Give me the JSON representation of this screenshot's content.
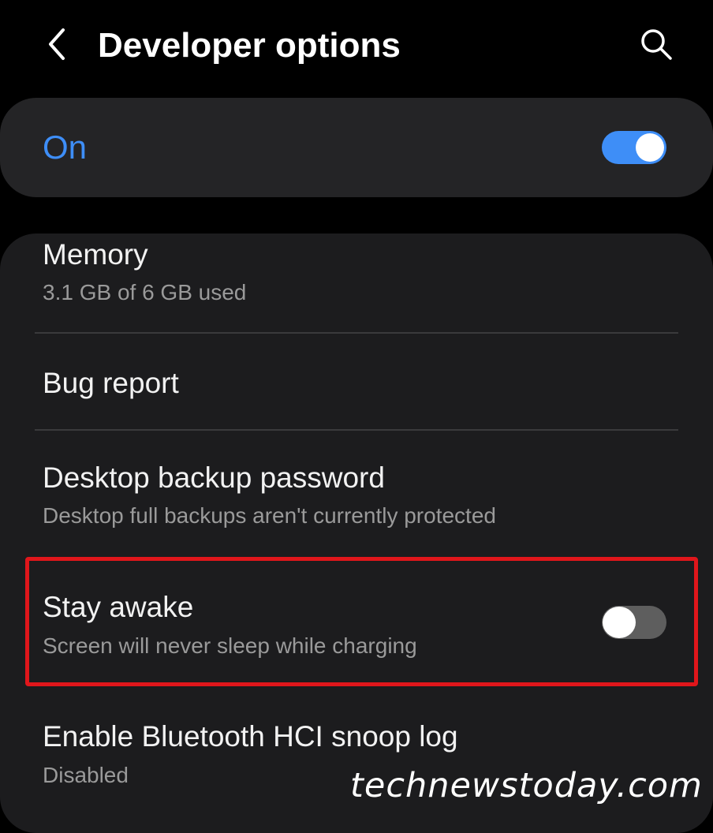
{
  "header": {
    "title": "Developer options",
    "back_icon": "chevron-left-icon",
    "search_icon": "search-icon"
  },
  "master_switch": {
    "label": "On",
    "state": true
  },
  "settings": [
    {
      "title": "Memory",
      "subtitle": "3.1 GB of 6 GB used"
    },
    {
      "title": "Bug report",
      "subtitle": ""
    },
    {
      "title": "Desktop backup password",
      "subtitle": "Desktop full backups aren't currently protected"
    },
    {
      "title": "Stay awake",
      "subtitle": "Screen will never sleep while charging",
      "toggle_state": false
    },
    {
      "title": "Enable Bluetooth HCI snoop log",
      "subtitle": "Disabled"
    }
  ],
  "watermark": "technewstoday.com",
  "colors": {
    "accent": "#3e8ef7",
    "highlight": "#e0161b",
    "card": "#1c1c1e",
    "master_card": "#242426"
  }
}
